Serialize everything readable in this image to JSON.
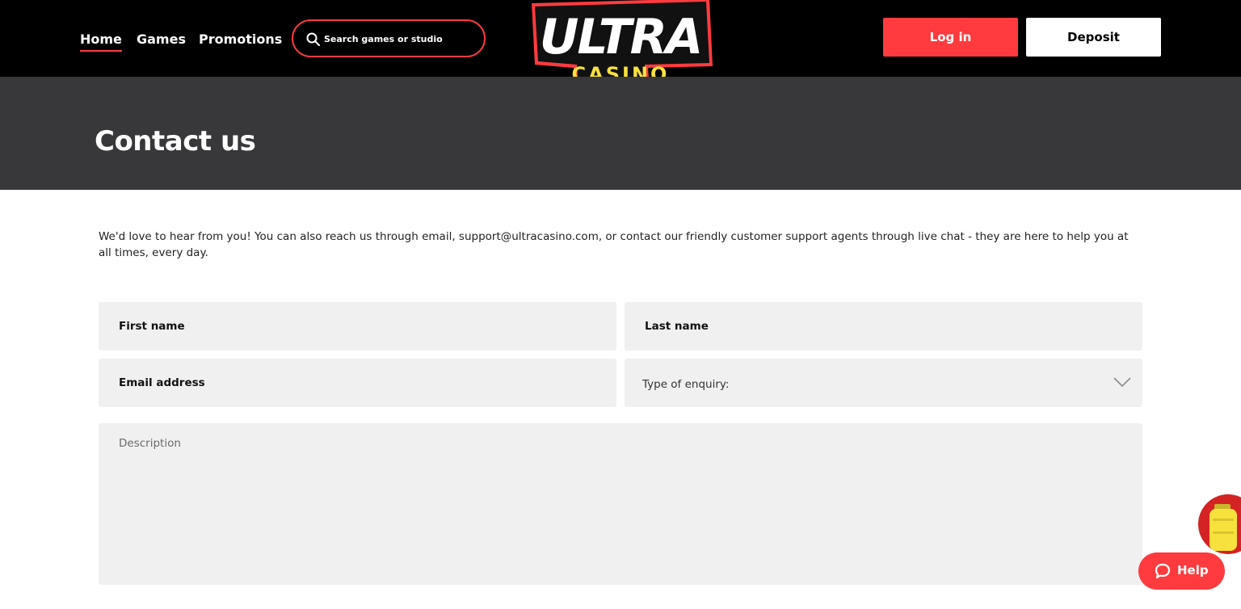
{
  "nav": {
    "items": [
      {
        "label": "Home",
        "active": true
      },
      {
        "label": "Games",
        "active": false
      },
      {
        "label": "Promotions",
        "active": false
      }
    ]
  },
  "search": {
    "placeholder": "Search games or studio",
    "icon": "search-icon"
  },
  "logo": {
    "line1": "ULTRA",
    "line2": "CASINO"
  },
  "header_buttons": {
    "login": "Log in",
    "deposit": "Deposit"
  },
  "hero": {
    "title": "Contact us"
  },
  "intro": {
    "text": "We'd love to hear from you! You can also reach us through email, support@ultracasino.com, or contact our friendly customer support agents through live chat - they are here to help you at all times, every day."
  },
  "form": {
    "first_name_placeholder": "First name",
    "last_name_placeholder": "Last name",
    "email_placeholder": "Email address",
    "enquiry_label": "Type of enquiry:",
    "description_placeholder": "Description"
  },
  "help": {
    "label": "Help",
    "icon": "chat-bubble-icon"
  },
  "colors": {
    "accent": "#ff3b3f",
    "header_bg": "#000000",
    "hero_bg": "#38373a",
    "field_bg": "#f1f0f1",
    "logo_yellow": "#f7e13c"
  }
}
